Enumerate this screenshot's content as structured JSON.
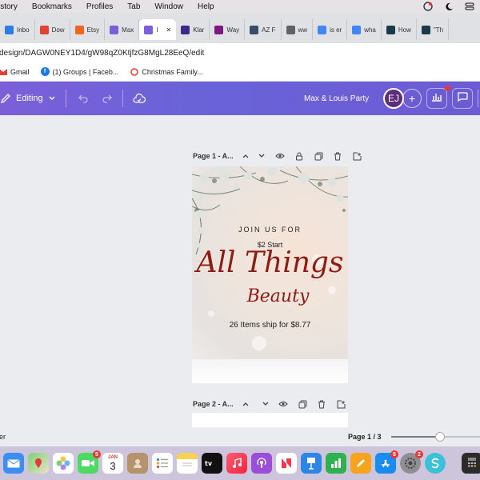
{
  "menubar": {
    "items": [
      "istory",
      "Bookmarks",
      "Profiles",
      "Tab",
      "Window",
      "Help"
    ]
  },
  "tabs": [
    {
      "label": "Inbo",
      "icon": "mail-icon",
      "color": "#2f7de1"
    },
    {
      "label": "Dow",
      "icon": "gmail-icon",
      "color": "#e34133"
    },
    {
      "label": "Etsy",
      "icon": "etsy-icon",
      "color": "#f1641e"
    },
    {
      "label": "Max",
      "icon": "canva-icon",
      "color": "#7b5fd9"
    },
    {
      "label": "I",
      "icon": "canva-icon",
      "color": "#7b5fd9",
      "active": true
    },
    {
      "label": "Klar",
      "icon": "k-icon",
      "color": "#3b2a8a"
    },
    {
      "label": "Way",
      "icon": "wayfair-icon",
      "color": "#7f187f"
    },
    {
      "label": "AZ F",
      "icon": "az-icon",
      "color": "#3a4a6a"
    },
    {
      "label": "ww",
      "icon": "globe-icon",
      "color": "#5f6368"
    },
    {
      "label": "is er",
      "icon": "google-icon",
      "color": "#4285f4"
    },
    {
      "label": "wha",
      "icon": "google-icon",
      "color": "#4285f4"
    },
    {
      "label": "How",
      "icon": "w-icon",
      "color": "#1a3a4a"
    },
    {
      "label": "\"Th",
      "icon": "w-icon",
      "color": "#1a3a4a"
    }
  ],
  "address": {
    "url": "design/DAGW0NEY1D4/gW98qZ0KtjfzG8MgL28EeQ/edit"
  },
  "bookmarks": [
    {
      "label": "Gmail",
      "icon": "gmail-icon"
    },
    {
      "label": "(1) Groups | Faceb...",
      "icon": "facebook-icon"
    },
    {
      "label": "Christmas Family...",
      "icon": "ornament-icon"
    }
  ],
  "canva": {
    "editing_label": "Editing",
    "design_title": "Max & Louis Party",
    "avatar_initials": "EJ"
  },
  "page1": {
    "label": "Page 1 - A..."
  },
  "page2": {
    "label": "Page 2 - A..."
  },
  "design": {
    "join": "JOIN US FOR",
    "start": "$2 Start",
    "script1": "All Things",
    "script2": "Beauty",
    "ship": "26 Items ship for $8.77"
  },
  "status": {
    "left": "er",
    "page_indicator": "Page 1 / 3",
    "zoom_fraction": 0.55
  },
  "dock": {
    "calendar_month": "JAN",
    "calendar_day": "3",
    "facetime_badge": "5",
    "appstore_badge": "5",
    "settings_badge": "2"
  }
}
